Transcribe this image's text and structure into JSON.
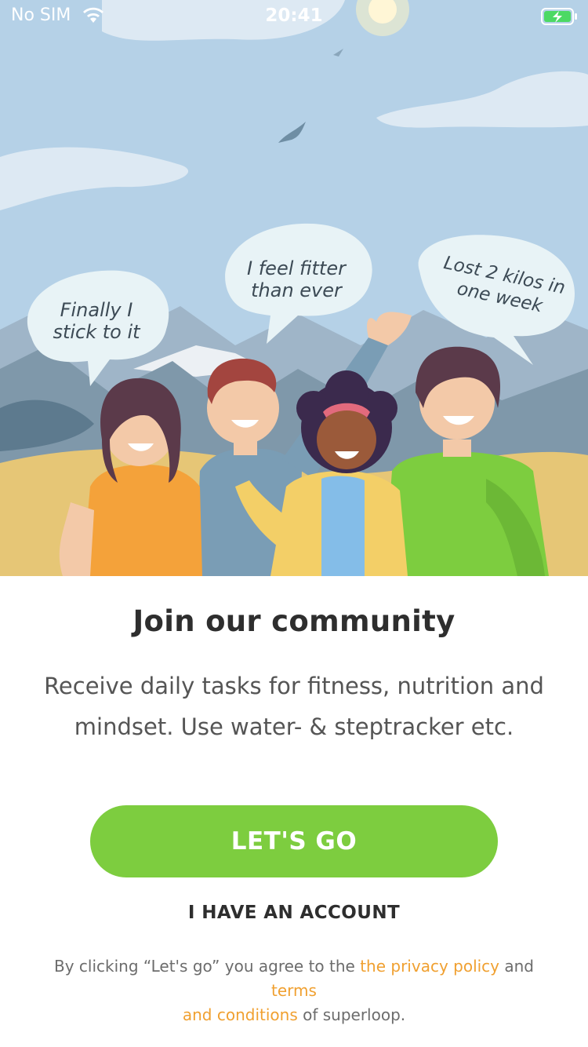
{
  "status_bar": {
    "carrier": "No SIM",
    "time": "20:41",
    "wifi_icon": "wifi-icon",
    "battery_icon": "battery-charging-icon"
  },
  "hero": {
    "bubbles": [
      {
        "line1": "Finally I",
        "line2": "stick to it"
      },
      {
        "line1": "I feel fitter",
        "line2": "than ever"
      },
      {
        "line1": "Lost 2 kilos in",
        "line2": "one week"
      }
    ]
  },
  "content": {
    "title": "Join our community",
    "subtitle_line1": "Receive daily tasks for fitness, nutrition and",
    "subtitle_line2": "mindset. Use water- & steptracker etc."
  },
  "actions": {
    "primary_label": "LET'S GO",
    "secondary_label": "I HAVE AN ACCOUNT"
  },
  "legal": {
    "prefix": "By clicking “Let's go” you agree to the ",
    "privacy_link": "the privacy policy",
    "middle": " and ",
    "terms_link_part1": "terms",
    "terms_link_part2": "and conditions",
    "suffix": " of superloop."
  },
  "colors": {
    "accent_green": "#7dcd3f",
    "link_orange": "#f0a030",
    "sky": "#b5d1e7"
  }
}
